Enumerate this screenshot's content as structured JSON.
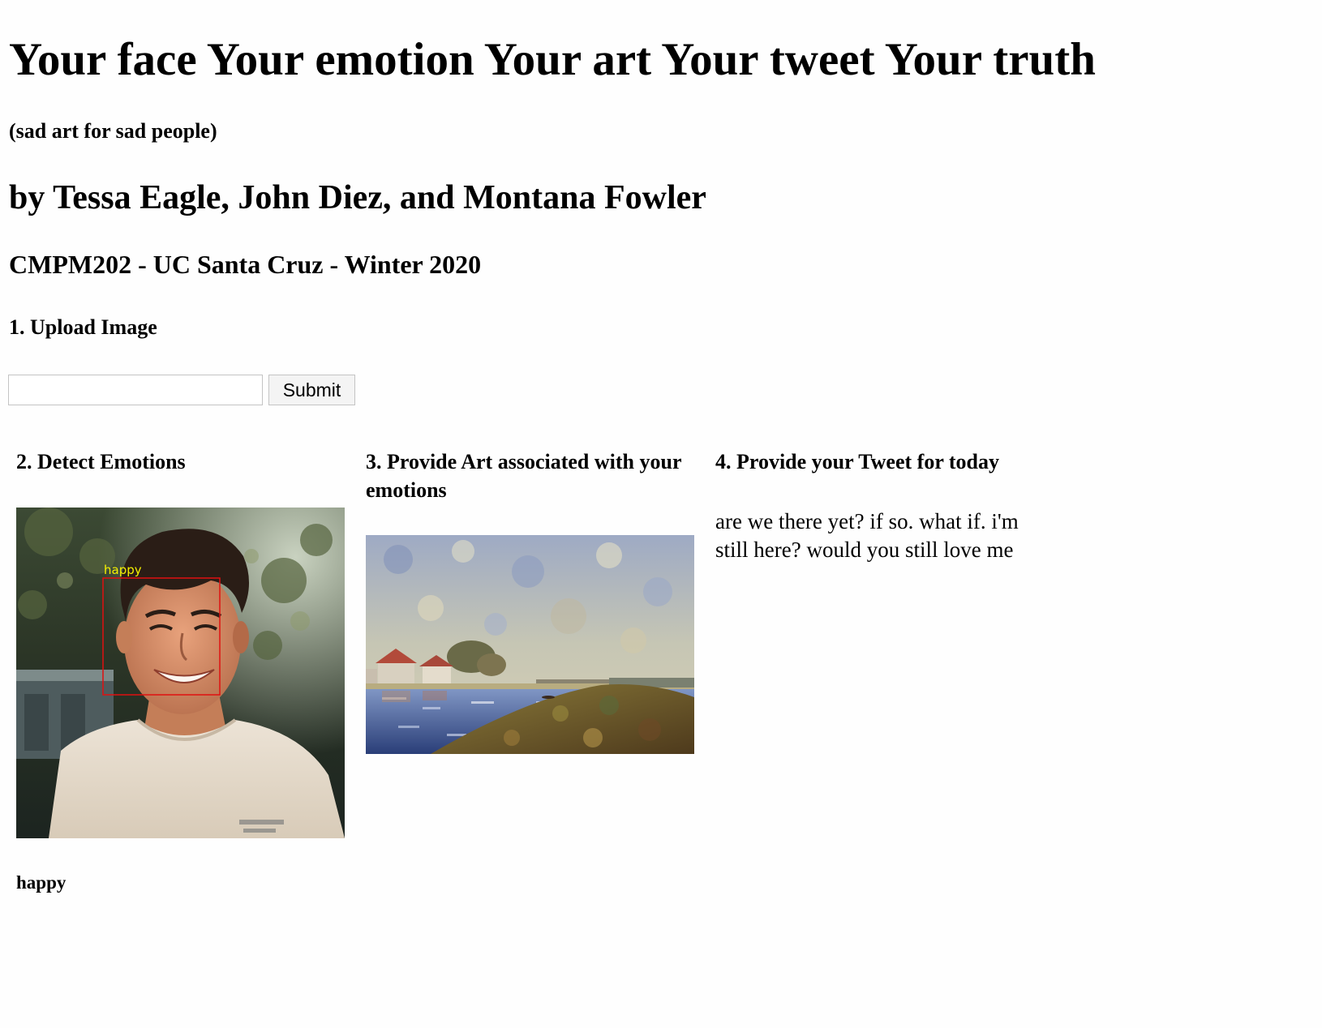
{
  "header": {
    "title": "Your face Your emotion Your art Your tweet Your truth",
    "subtitle": "(sad art for sad people)",
    "authors": "by Tessa Eagle, John Diez, and Montana Fowler",
    "course": "CMPM202 - UC Santa Cruz - Winter 2020"
  },
  "upload": {
    "heading": "1. Upload Image",
    "input_value": "",
    "submit_label": "Submit"
  },
  "detect": {
    "heading": "2. Detect Emotions",
    "face_label": "happy",
    "result": "happy"
  },
  "art": {
    "heading": "3. Provide Art associated with your emotions"
  },
  "tweet": {
    "heading": "4. Provide your Tweet for today",
    "text": "are we there yet? if so. what if. i'm still here? would you still love me"
  },
  "colors": {
    "detection_box": "#e01010",
    "detection_label": "#f4f000",
    "background": "#fefefe"
  }
}
